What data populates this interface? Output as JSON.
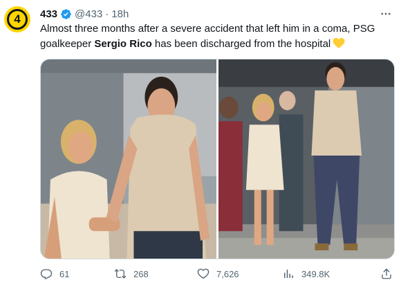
{
  "tweet": {
    "avatar": {
      "label": "4",
      "bg_color": "#ffd500"
    },
    "display_name": "433",
    "verified_color": "#1d9bf0",
    "handle": "@433",
    "separator": "·",
    "time": "18h",
    "text_before": "Almost three months after a severe accident that left him in a coma, PSG goalkeeper ",
    "text_bold": "Sergio Rico",
    "text_after": " has been discharged from the hospital",
    "emoji": "yellow-heart"
  },
  "media": {
    "photos": [
      {
        "name": "photo-left"
      },
      {
        "name": "photo-right"
      }
    ]
  },
  "actions": {
    "replies": "61",
    "retweets": "268",
    "likes": "7,626",
    "views": "349.8K"
  },
  "colors": {
    "text": "#0f1419",
    "secondary": "#536471",
    "accent": "#1d9bf0"
  }
}
